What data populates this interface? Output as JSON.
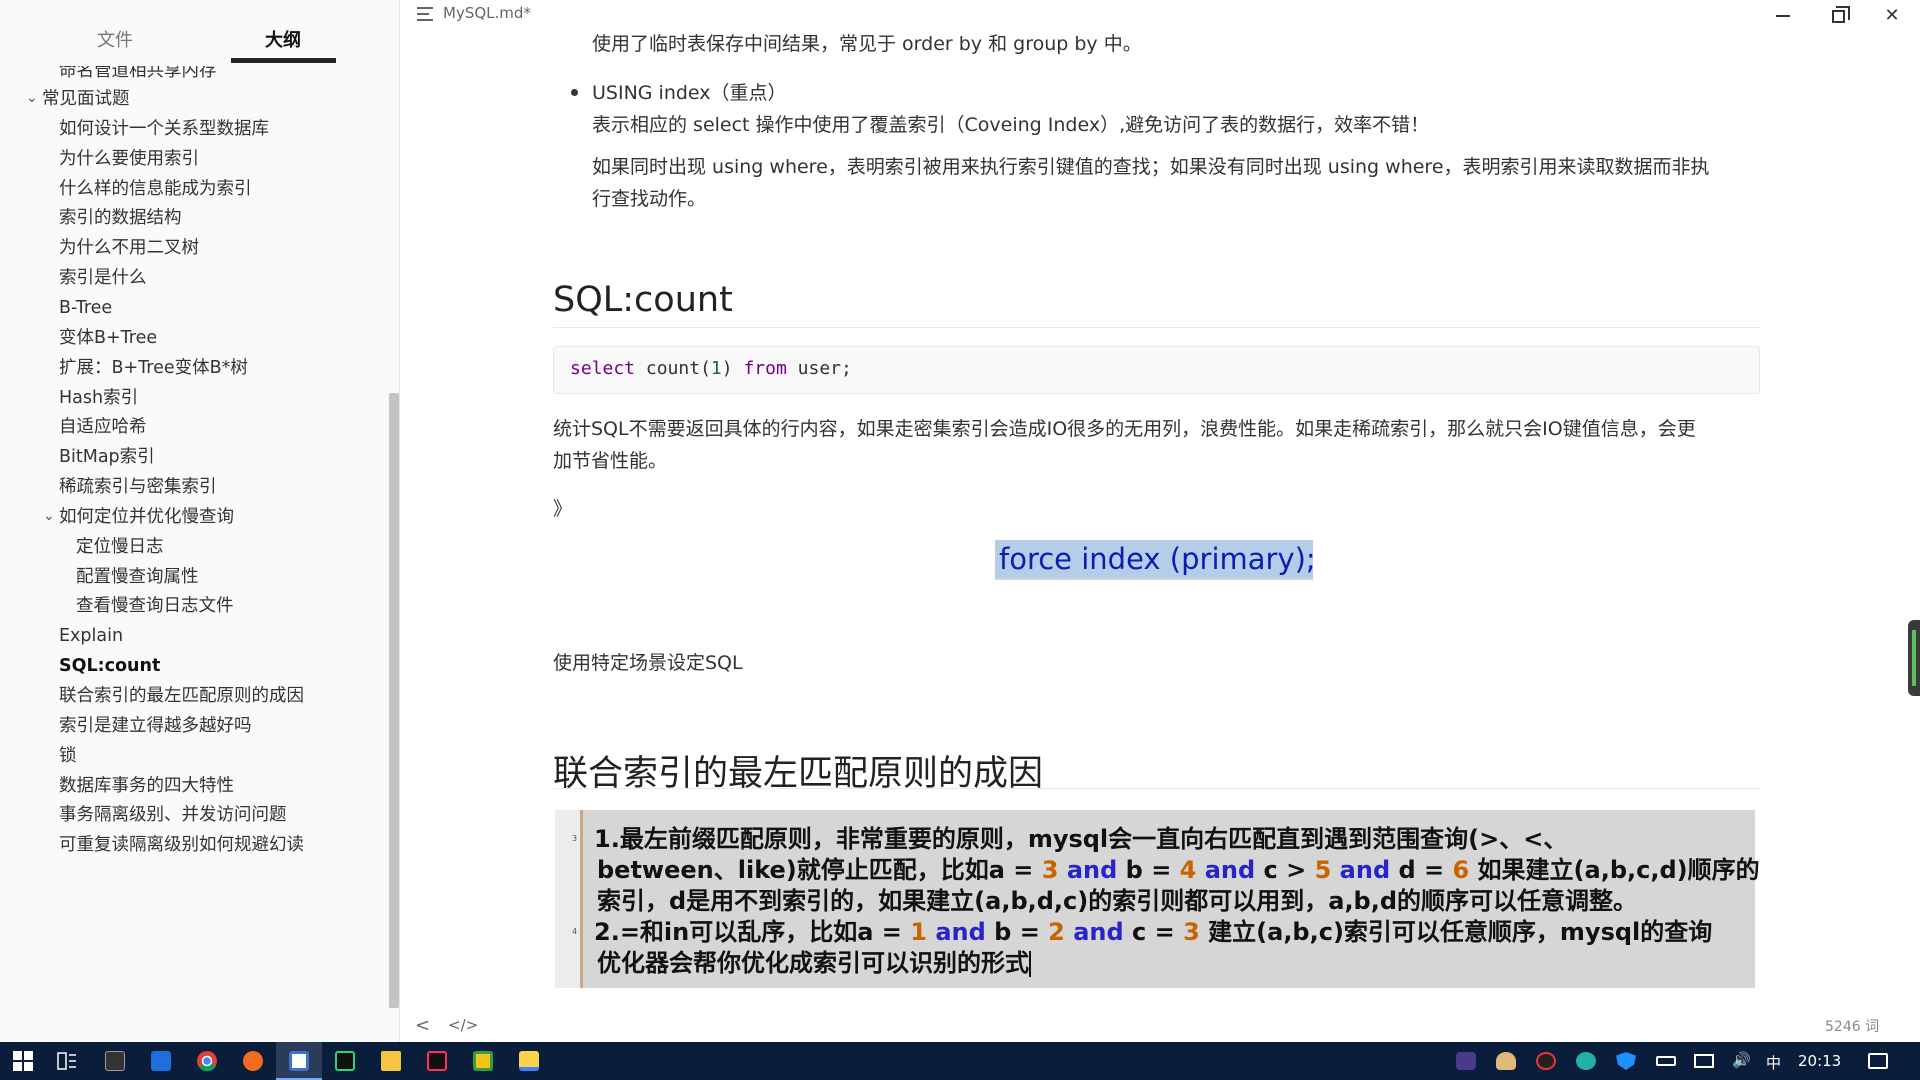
{
  "sidebar": {
    "tabs": {
      "files": "文件",
      "outline": "大纲"
    },
    "partial_top": "命名管道相共享内存",
    "items": [
      {
        "label": "常见面试题",
        "level": 0,
        "expanded": true
      },
      {
        "label": "如何设计一个关系型数据库",
        "level": 1
      },
      {
        "label": "为什么要使用索引",
        "level": 1
      },
      {
        "label": "什么样的信息能成为索引",
        "level": 1
      },
      {
        "label": "索引的数据结构",
        "level": 1
      },
      {
        "label": "为什么不用二叉树",
        "level": 1
      },
      {
        "label": "索引是什么",
        "level": 1
      },
      {
        "label": "B-Tree",
        "level": 1
      },
      {
        "label": "变体B+Tree",
        "level": 1
      },
      {
        "label": "扩展：B+Tree变体B*树",
        "level": 1
      },
      {
        "label": "Hash索引",
        "level": 1
      },
      {
        "label": "自适应哈希",
        "level": 1
      },
      {
        "label": "BitMap索引",
        "level": 1
      },
      {
        "label": "稀疏索引与密集索引",
        "level": 1
      },
      {
        "label": "如何定位并优化慢查询",
        "level": 1,
        "expanded": true
      },
      {
        "label": "定位慢日志",
        "level": 2
      },
      {
        "label": "配置慢查询属性",
        "level": 2
      },
      {
        "label": "查看慢查询日志文件",
        "level": 2
      },
      {
        "label": "Explain",
        "level": 1
      },
      {
        "label": "SQL:count",
        "level": 1,
        "active": true
      },
      {
        "label": "联合索引的最左匹配原则的成因",
        "level": 1
      },
      {
        "label": "索引是建立得越多越好吗",
        "level": 1
      },
      {
        "label": "锁",
        "level": 1
      },
      {
        "label": "数据库事务的四大特性",
        "level": 1
      },
      {
        "label": "事务隔离级别、并发访问问题",
        "level": 1
      },
      {
        "label": "可重复读隔离级别如何规避幻读",
        "level": 1
      }
    ]
  },
  "titlebar": {
    "doc_title": "MySQL.md*"
  },
  "editor": {
    "p_temp_table": "使用了临时表保存中间结果，常见于 order by 和 group by 中。",
    "bullet_using_index": "USING index（重点）",
    "p_cover_index": "表示相应的 select 操作中使用了覆盖索引（Coveing Index）,避免访问了表的数据行，效率不错！",
    "p_using_where_1": "如果同时出现 using where，表明索引被用来执行索引键值的查找；如果没有同时出现 using where，表明索引用来读取数据而非执",
    "p_using_where_2": "行查找动作。",
    "h2_sql_count": "SQL:count",
    "code": {
      "kw_select": "select",
      "fn_count": "count",
      "arg": "1",
      "kw_from": "from",
      "rest": "user;"
    },
    "p_count_1": "统计SQL不需要返回具体的行内容，如果走密集索引会造成IO很多的无用列，浪费性能。如果走稀疏索引，那么就只会IO键值信息，会更",
    "p_count_2": "加节省性能。",
    "symbol": "》",
    "force_index_image_text": "force index (primary);",
    "p_scene": "使用特定场景设定SQL",
    "h2_leftmost": "联合索引的最左匹配原则的成因",
    "rule_image": {
      "gutter": [
        "3",
        "4"
      ],
      "l1": "1.最左前缀匹配原则，非常重要的原则，mysql会一直向右匹配直到遇到范围查询(>、<、",
      "l2_a": "between、like)就停止匹配，比如a = ",
      "l2_3": "3",
      "l2_and1": "and",
      "l2_b": " b = ",
      "l2_4": "4",
      "l2_and2": "and",
      "l2_c": " c > ",
      "l2_5": "5",
      "l2_and3": "and",
      "l2_d": " d = ",
      "l2_6": "6",
      "l2_e": " 如果建立(a,b,c,d)顺序的",
      "l3": "索引，d是用不到索引的，如果建立(a,b,d,c)的索引则都可以用到，a,b,d的顺序可以任意调整。",
      "l4_a": "2.=和in可以乱序，比如a = ",
      "l4_1": "1",
      "l4_and1": "and",
      "l4_b": " b = ",
      "l4_2": "2",
      "l4_and2": "and",
      "l4_c": " c = ",
      "l4_3": "3",
      "l4_d": " 建立(a,b,c)索引可以任意顺序，mysql的查询",
      "l5": "优化器会帮你优化成索引可以识别的形式"
    }
  },
  "footer": {
    "word_count": "5246 词",
    "back_glyph": "<",
    "code_glyph": "</>"
  },
  "taskbar": {
    "ime": "中",
    "clock": "20:13"
  },
  "colors": {
    "sidebar_bg": "#fafafa",
    "taskbar_bg": "#0a1e3c",
    "keyword": "#770088",
    "number_in_image": "#c86400",
    "and_in_image": "#2525c8"
  }
}
